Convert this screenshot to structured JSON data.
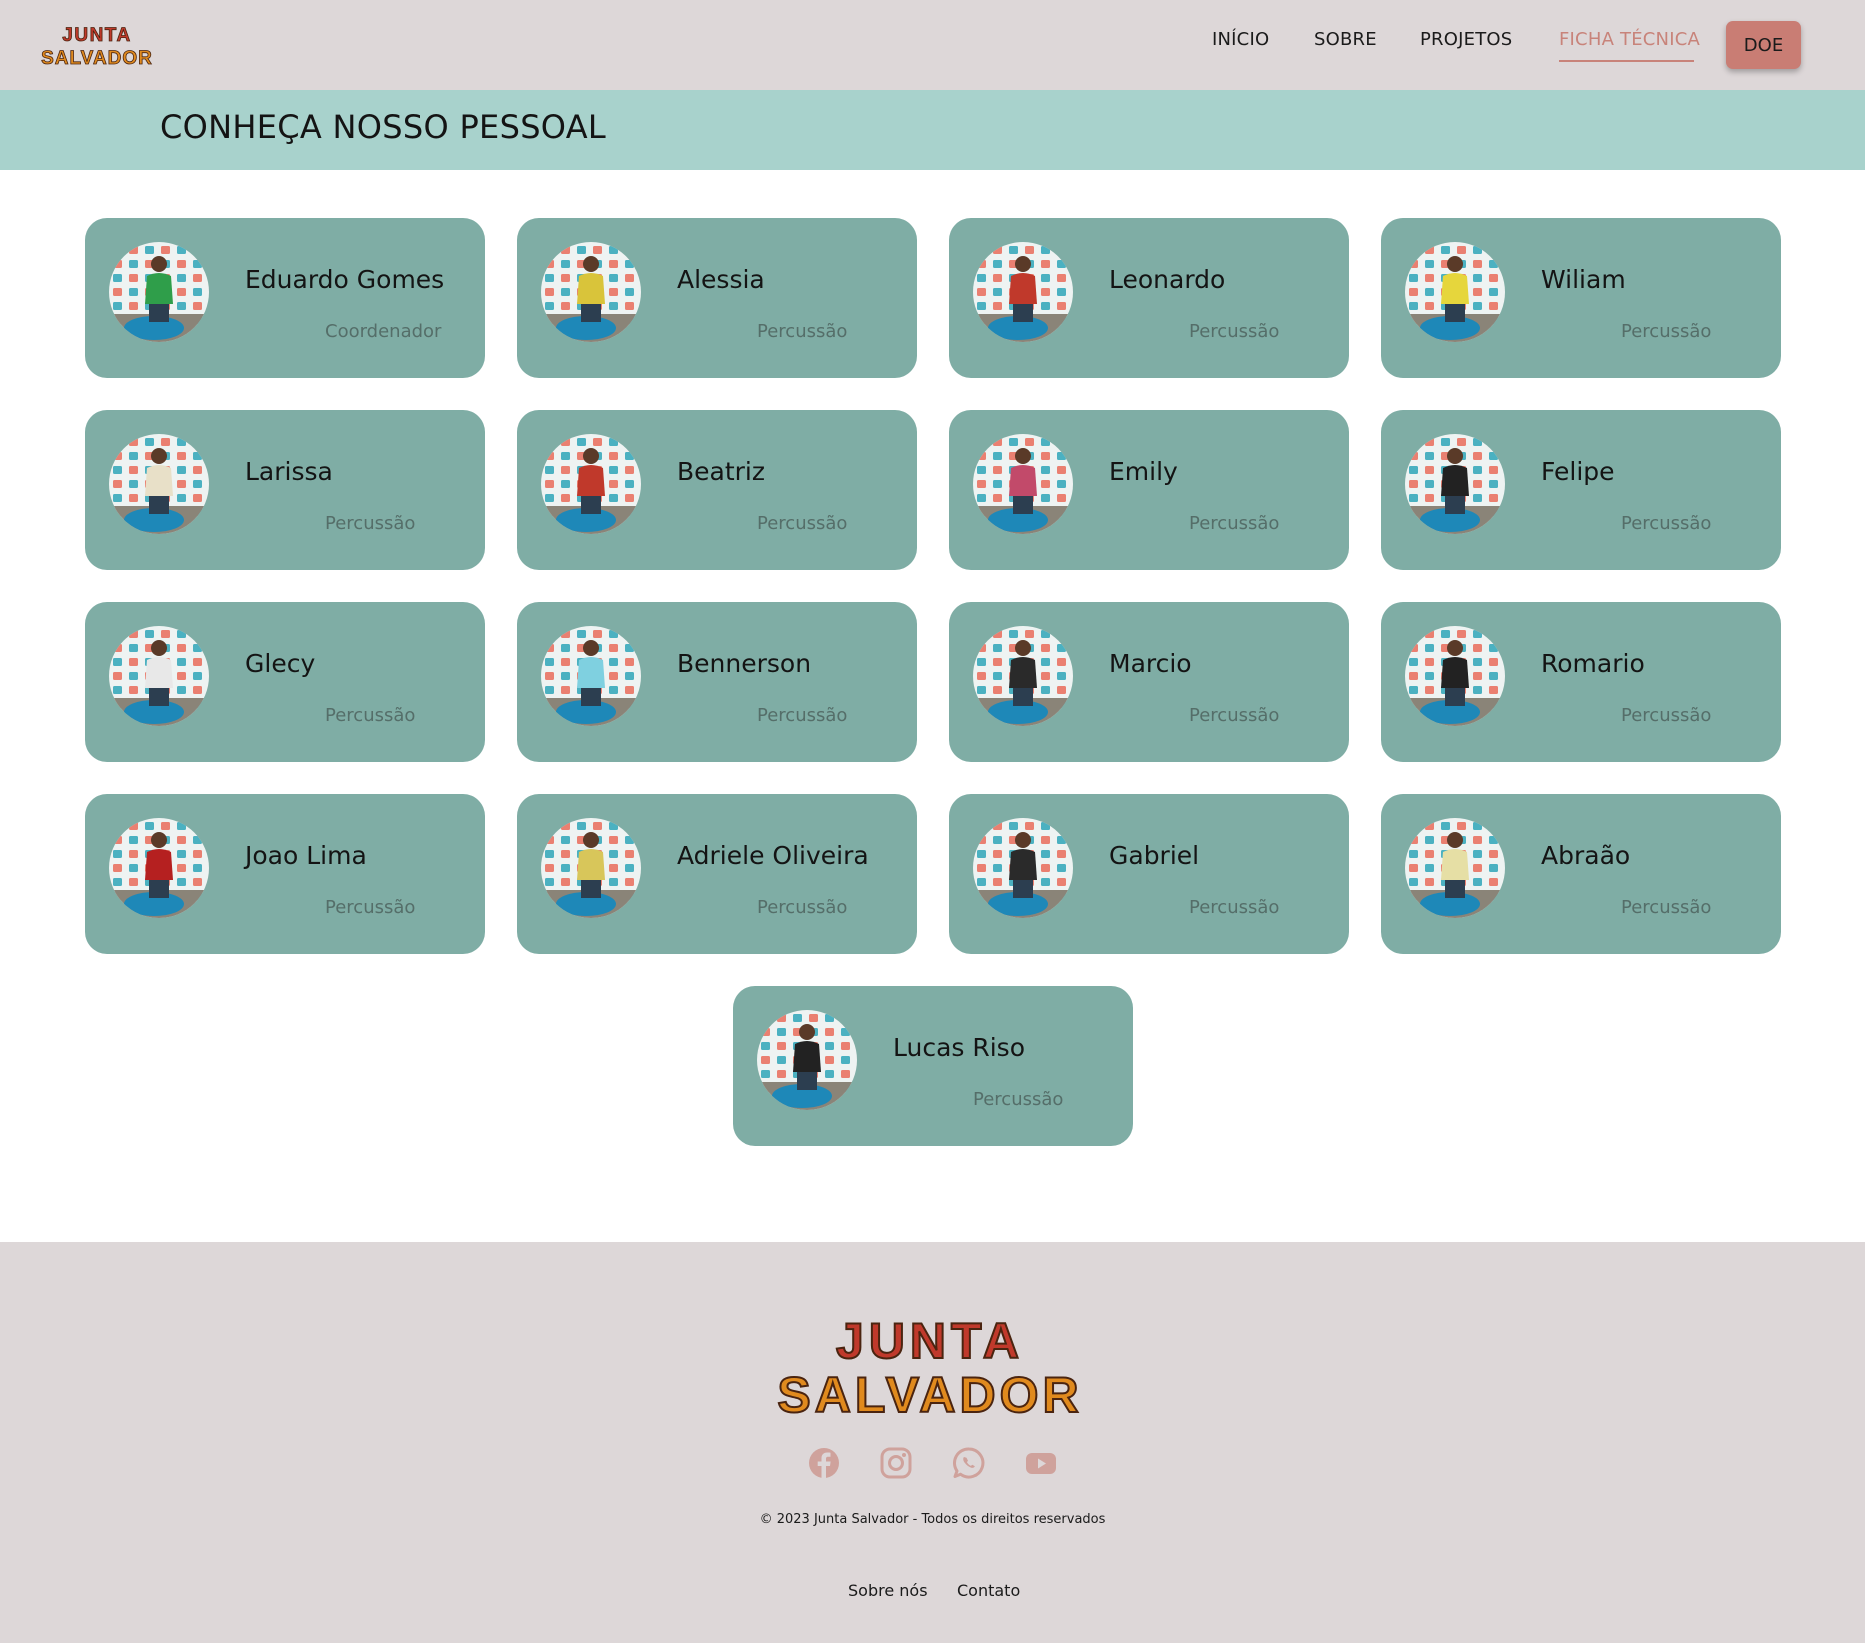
{
  "brand": {
    "line1": "JUNTA",
    "line2": "SALVADOR"
  },
  "nav": {
    "items": [
      {
        "label": "INÍCIO"
      },
      {
        "label": "SOBRE"
      },
      {
        "label": "PROJETOS"
      },
      {
        "label": "FICHA TÉCNICA",
        "active": true
      }
    ],
    "donate_label": "DOE"
  },
  "page": {
    "title": "CONHEÇA NOSSO PESSOAL"
  },
  "team": [
    {
      "name": "Eduardo Gomes",
      "role": "Coordenador"
    },
    {
      "name": "Alessia",
      "role": "Percussão"
    },
    {
      "name": "Leonardo",
      "role": "Percussão"
    },
    {
      "name": "Wiliam",
      "role": "Percussão"
    },
    {
      "name": "Larissa",
      "role": "Percussão"
    },
    {
      "name": "Beatriz",
      "role": "Percussão"
    },
    {
      "name": "Emily",
      "role": "Percussão"
    },
    {
      "name": "Felipe",
      "role": "Percussão"
    },
    {
      "name": "Glecy",
      "role": "Percussão"
    },
    {
      "name": "Bennerson",
      "role": "Percussão"
    },
    {
      "name": "Marcio",
      "role": "Percussão"
    },
    {
      "name": "Romario",
      "role": "Percussão"
    },
    {
      "name": "Joao Lima",
      "role": "Percussão"
    },
    {
      "name": "Adriele Oliveira",
      "role": "Percussão"
    },
    {
      "name": "Gabriel",
      "role": "Percussão"
    },
    {
      "name": "Abraão",
      "role": "Percussão"
    },
    {
      "name": "Lucas Riso",
      "role": "Percussão"
    }
  ],
  "footer": {
    "logo_line1": "JUNTA",
    "logo_line2": "SALVADOR",
    "social_icons": [
      "facebook-icon",
      "instagram-icon",
      "whatsapp-icon",
      "youtube-icon"
    ],
    "copyright": "© 2023 Junta Salvador - Todos os direitos reservados",
    "links": [
      {
        "label": "Sobre nós"
      },
      {
        "label": "Contato"
      }
    ]
  },
  "colors": {
    "header_bg": "#ddd7d8",
    "band_bg": "#a8d2cc",
    "card_bg": "#7fada5",
    "accent": "#c97d74",
    "social_icon": "#cfa29c"
  }
}
